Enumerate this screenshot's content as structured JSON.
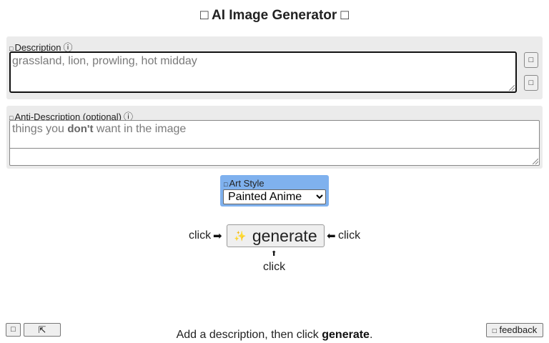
{
  "header": {
    "title": "□ AI Image Generator □"
  },
  "description": {
    "label": "Description",
    "label_icon": "□",
    "info_icon": "ⓘ",
    "placeholder": "grassland, lion, prowling, hot midday",
    "side_button_1": "□",
    "side_button_2": "□"
  },
  "anti_description": {
    "label": "Anti-Description (optional)",
    "label_icon": "□",
    "info_icon": "ⓘ",
    "placeholder_before": "things you ",
    "placeholder_bold": "don't",
    "placeholder_after": " want in the image"
  },
  "art_style": {
    "label": "Art Style",
    "label_icon": "□",
    "selected": "Painted Anime"
  },
  "generate": {
    "label": "generate",
    "sparkle": "✨",
    "hint_left": "click",
    "hint_right": "click",
    "hint_below": "click",
    "arrow_right": "➡",
    "arrow_left": "⬅",
    "arrow_up": "⬆"
  },
  "status": {
    "before": "Add a description, then click ",
    "bold": "generate",
    "after": "."
  },
  "footer": {
    "small_button_1": "□",
    "small_button_2": "⇱",
    "feedback_icon": "□",
    "feedback_label": "feedback"
  }
}
